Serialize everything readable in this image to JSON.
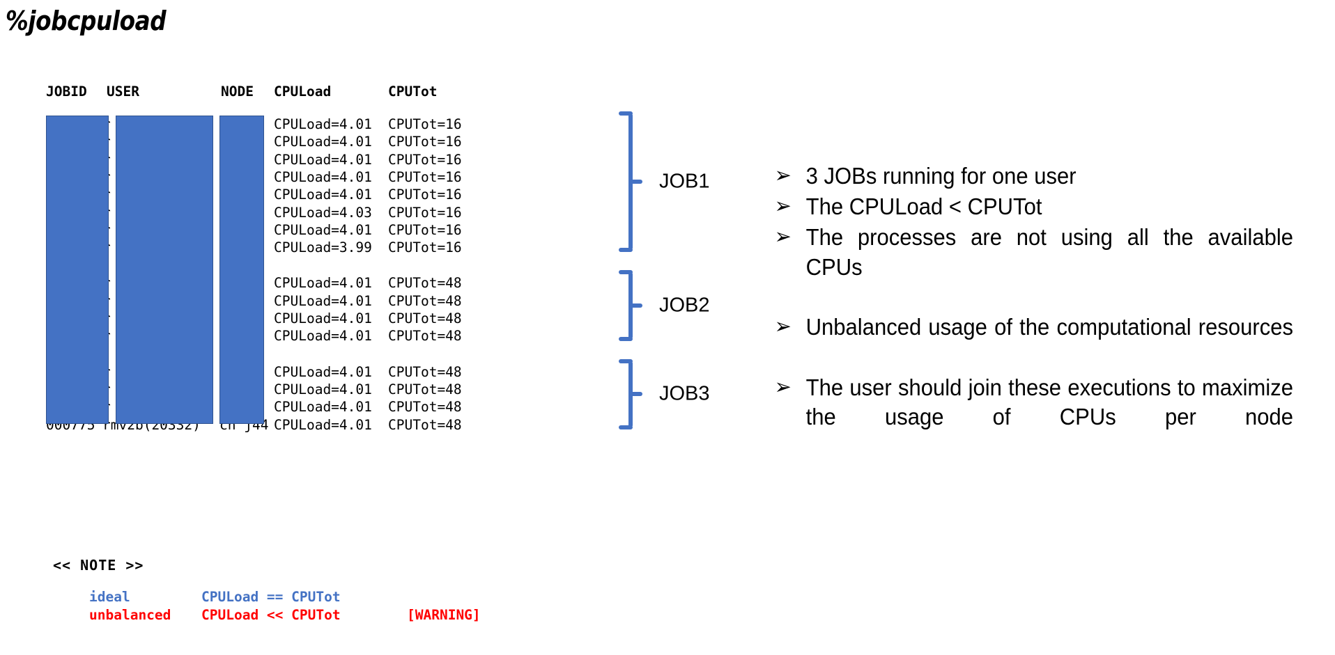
{
  "title": "%jobcpuload",
  "table": {
    "headers": {
      "jobid": "JOBID",
      "user": "USER",
      "node": "NODE",
      "cpuload": "CPULoad",
      "cputot": "CPUTot"
    },
    "redacted_hint_char": "r",
    "partial_bottom_row": {
      "jobid": "000775",
      "user": "mv2b(20332)",
      "node": "cn j44"
    },
    "rows": [
      {
        "group": "JOB1",
        "cpuload": "CPULoad=4.01",
        "cputot": "CPUTot=16"
      },
      {
        "group": "JOB1",
        "cpuload": "CPULoad=4.01",
        "cputot": "CPUTot=16"
      },
      {
        "group": "JOB1",
        "cpuload": "CPULoad=4.01",
        "cputot": "CPUTot=16"
      },
      {
        "group": "JOB1",
        "cpuload": "CPULoad=4.01",
        "cputot": "CPUTot=16"
      },
      {
        "group": "JOB1",
        "cpuload": "CPULoad=4.01",
        "cputot": "CPUTot=16"
      },
      {
        "group": "JOB1",
        "cpuload": "CPULoad=4.03",
        "cputot": "CPUTot=16"
      },
      {
        "group": "JOB1",
        "cpuload": "CPULoad=4.01",
        "cputot": "CPUTot=16"
      },
      {
        "group": "JOB1",
        "cpuload": "CPULoad=3.99",
        "cputot": "CPUTot=16"
      },
      {
        "group": "JOB2",
        "cpuload": "CPULoad=4.01",
        "cputot": "CPUTot=48"
      },
      {
        "group": "JOB2",
        "cpuload": "CPULoad=4.01",
        "cputot": "CPUTot=48"
      },
      {
        "group": "JOB2",
        "cpuload": "CPULoad=4.01",
        "cputot": "CPUTot=48"
      },
      {
        "group": "JOB2",
        "cpuload": "CPULoad=4.01",
        "cputot": "CPUTot=48"
      },
      {
        "group": "JOB3",
        "cpuload": "CPULoad=4.01",
        "cputot": "CPUTot=48"
      },
      {
        "group": "JOB3",
        "cpuload": "CPULoad=4.01",
        "cputot": "CPUTot=48"
      },
      {
        "group": "JOB3",
        "cpuload": "CPULoad=4.01",
        "cputot": "CPUTot=48"
      },
      {
        "group": "JOB3",
        "cpuload": "CPULoad=4.01",
        "cputot": "CPUTot=48"
      }
    ]
  },
  "job_groups": [
    {
      "label": "JOB1",
      "row_count": 8
    },
    {
      "label": "JOB2",
      "row_count": 4
    },
    {
      "label": "JOB3",
      "row_count": 4
    }
  ],
  "note": {
    "title": "<< NOTE >>",
    "lines": [
      {
        "label": "ideal",
        "expression": "CPULoad == CPUTot",
        "tag": "",
        "color": "#4472C4"
      },
      {
        "label": "unbalanced",
        "expression": "CPULoad << CPUTot",
        "tag": "[WARNING]",
        "color": "#FF0000"
      }
    ]
  },
  "bullets": {
    "marker": "➢",
    "items": [
      {
        "text": "3 JOBs running for one user",
        "justified": false
      },
      {
        "text": "The CPULoad < CPUTot",
        "justified": false
      },
      {
        "text": "The processes are not using all the available CPUs",
        "justified": true
      },
      {
        "text": "Unbalanced usage of the computational resources",
        "justified": true
      },
      {
        "text": "The user should join these executions to maximize the usage of CPUs per node",
        "justified": true
      }
    ]
  },
  "colors": {
    "redaction_blue": "#4472C4",
    "brace_blue": "#4472C4",
    "warning_red": "#FF0000"
  }
}
